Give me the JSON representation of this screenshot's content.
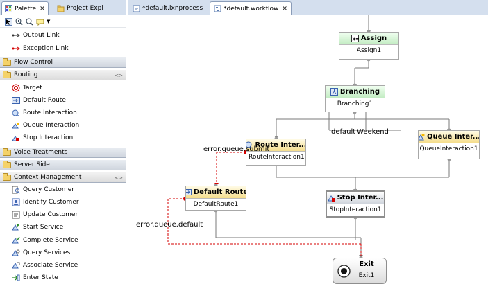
{
  "palette_view": {
    "tabs": [
      {
        "label": "Palette",
        "close": "✕"
      },
      {
        "label": "Project Expl",
        "close": ""
      }
    ]
  },
  "palette": {
    "top_items": [
      {
        "label": "Output Link",
        "icon": "output-link-icon"
      },
      {
        "label": "Exception Link",
        "icon": "exception-link-icon"
      }
    ],
    "flow_control": "Flow Control",
    "routing": {
      "label": "Routing",
      "items": [
        {
          "label": "Target",
          "icon": "target-icon"
        },
        {
          "label": "Default Route",
          "icon": "default-route-icon"
        },
        {
          "label": "Route Interaction",
          "icon": "route-interaction-icon"
        },
        {
          "label": "Queue Interaction",
          "icon": "queue-interaction-icon"
        },
        {
          "label": "Stop Interaction",
          "icon": "stop-interaction-icon"
        }
      ]
    },
    "voice_treatments": "Voice Treatments",
    "server_side": "Server Side",
    "context_management": {
      "label": "Context Management",
      "items": [
        {
          "label": "Query Customer",
          "icon": "query-customer-icon"
        },
        {
          "label": "Identify Customer",
          "icon": "identify-customer-icon"
        },
        {
          "label": "Update Customer",
          "icon": "update-customer-icon"
        },
        {
          "label": "Start Service",
          "icon": "start-service-icon"
        },
        {
          "label": "Complete Service",
          "icon": "complete-service-icon"
        },
        {
          "label": "Query Services",
          "icon": "query-services-icon"
        },
        {
          "label": "Associate Service",
          "icon": "associate-service-icon"
        },
        {
          "label": "Enter State",
          "icon": "enter-state-icon"
        }
      ]
    }
  },
  "editor": {
    "tabs": [
      {
        "label": "*default.ixnprocess",
        "close": ""
      },
      {
        "label": "*default.workflow",
        "close": "✕"
      }
    ]
  },
  "workflow": {
    "nodes": {
      "assign": {
        "title": "Assign",
        "name": "Assign1"
      },
      "branching": {
        "title": "Branching",
        "name": "Branching1"
      },
      "route": {
        "title": "Route Inter...",
        "name": "RouteInteraction1"
      },
      "queue": {
        "title": "Queue Inter...",
        "name": "QueueInteraction1"
      },
      "default_route": {
        "title": "Default Route",
        "name": "DefaultRoute1"
      },
      "stop": {
        "title": "Stop Inter...",
        "name": "StopInteraction1"
      },
      "exit": {
        "title": "Exit",
        "name": "Exit1"
      }
    },
    "labels": {
      "default": "default",
      "weekend": "Weekend",
      "error_submit": "error.queue.submit",
      "error_default": "error.queue.default"
    }
  },
  "colors": {
    "exception_link": "#d40000",
    "connector": "#7a7a7a",
    "tab_bar": "#d4dfee",
    "green_header": "#c3ecc3",
    "yellow_header": "#f5dd8c"
  }
}
